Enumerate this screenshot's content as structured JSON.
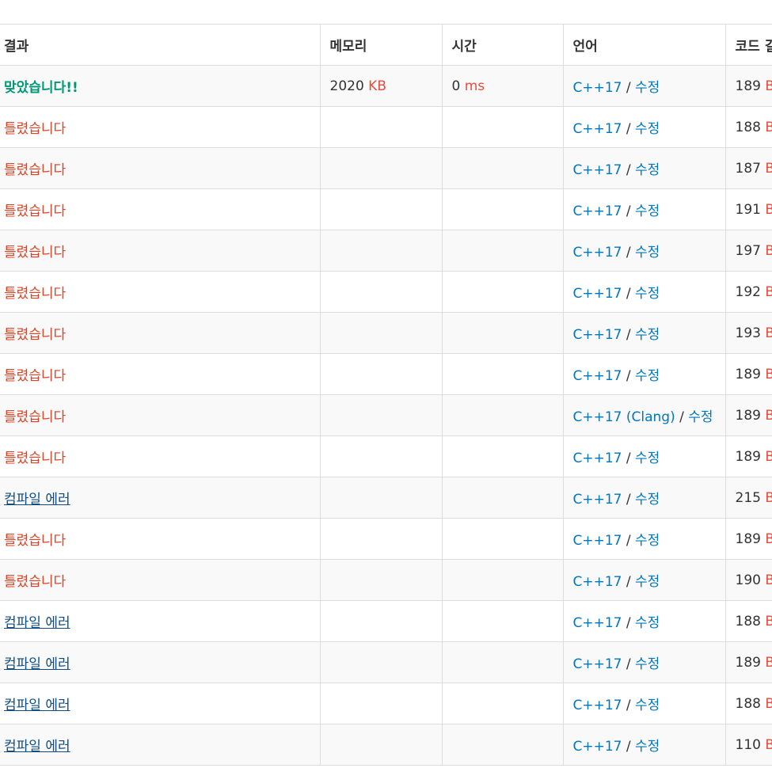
{
  "headers": {
    "result": "결과",
    "memory": "메모리",
    "time": "시간",
    "language": "언어",
    "code_length": "코드 길이"
  },
  "separator": " / ",
  "rows": [
    {
      "result": "맞았습니다!!",
      "result_type": "ac",
      "memory": "2020",
      "memory_unit": "KB",
      "time": "0",
      "time_unit": "ms",
      "language": "C++17",
      "edit": "수정",
      "code_length": "189",
      "code_unit": "B"
    },
    {
      "result": "틀렸습니다",
      "result_type": "wa",
      "memory": "",
      "memory_unit": "",
      "time": "",
      "time_unit": "",
      "language": "C++17",
      "edit": "수정",
      "code_length": "188",
      "code_unit": "B"
    },
    {
      "result": "틀렸습니다",
      "result_type": "wa",
      "memory": "",
      "memory_unit": "",
      "time": "",
      "time_unit": "",
      "language": "C++17",
      "edit": "수정",
      "code_length": "187",
      "code_unit": "B"
    },
    {
      "result": "틀렸습니다",
      "result_type": "wa",
      "memory": "",
      "memory_unit": "",
      "time": "",
      "time_unit": "",
      "language": "C++17",
      "edit": "수정",
      "code_length": "191",
      "code_unit": "B"
    },
    {
      "result": "틀렸습니다",
      "result_type": "wa",
      "memory": "",
      "memory_unit": "",
      "time": "",
      "time_unit": "",
      "language": "C++17",
      "edit": "수정",
      "code_length": "197",
      "code_unit": "B"
    },
    {
      "result": "틀렸습니다",
      "result_type": "wa",
      "memory": "",
      "memory_unit": "",
      "time": "",
      "time_unit": "",
      "language": "C++17",
      "edit": "수정",
      "code_length": "192",
      "code_unit": "B"
    },
    {
      "result": "틀렸습니다",
      "result_type": "wa",
      "memory": "",
      "memory_unit": "",
      "time": "",
      "time_unit": "",
      "language": "C++17",
      "edit": "수정",
      "code_length": "193",
      "code_unit": "B"
    },
    {
      "result": "틀렸습니다",
      "result_type": "wa",
      "memory": "",
      "memory_unit": "",
      "time": "",
      "time_unit": "",
      "language": "C++17",
      "edit": "수정",
      "code_length": "189",
      "code_unit": "B"
    },
    {
      "result": "틀렸습니다",
      "result_type": "wa",
      "memory": "",
      "memory_unit": "",
      "time": "",
      "time_unit": "",
      "language": "C++17 (Clang)",
      "edit": "수정",
      "code_length": "189",
      "code_unit": "B"
    },
    {
      "result": "틀렸습니다",
      "result_type": "wa",
      "memory": "",
      "memory_unit": "",
      "time": "",
      "time_unit": "",
      "language": "C++17",
      "edit": "수정",
      "code_length": "189",
      "code_unit": "B"
    },
    {
      "result": "컴파일 에러",
      "result_type": "ce",
      "memory": "",
      "memory_unit": "",
      "time": "",
      "time_unit": "",
      "language": "C++17",
      "edit": "수정",
      "code_length": "215",
      "code_unit": "B"
    },
    {
      "result": "틀렸습니다",
      "result_type": "wa",
      "memory": "",
      "memory_unit": "",
      "time": "",
      "time_unit": "",
      "language": "C++17",
      "edit": "수정",
      "code_length": "189",
      "code_unit": "B"
    },
    {
      "result": "틀렸습니다",
      "result_type": "wa",
      "memory": "",
      "memory_unit": "",
      "time": "",
      "time_unit": "",
      "language": "C++17",
      "edit": "수정",
      "code_length": "190",
      "code_unit": "B"
    },
    {
      "result": "컴파일 에러",
      "result_type": "ce",
      "memory": "",
      "memory_unit": "",
      "time": "",
      "time_unit": "",
      "language": "C++17",
      "edit": "수정",
      "code_length": "188",
      "code_unit": "B"
    },
    {
      "result": "컴파일 에러",
      "result_type": "ce",
      "memory": "",
      "memory_unit": "",
      "time": "",
      "time_unit": "",
      "language": "C++17",
      "edit": "수정",
      "code_length": "189",
      "code_unit": "B"
    },
    {
      "result": "컴파일 에러",
      "result_type": "ce",
      "memory": "",
      "memory_unit": "",
      "time": "",
      "time_unit": "",
      "language": "C++17",
      "edit": "수정",
      "code_length": "188",
      "code_unit": "B"
    },
    {
      "result": "컴파일 에러",
      "result_type": "ce",
      "memory": "",
      "memory_unit": "",
      "time": "",
      "time_unit": "",
      "language": "C++17",
      "edit": "수정",
      "code_length": "110",
      "code_unit": "B"
    }
  ],
  "colors": {
    "accepted": "#009874",
    "wrong": "#dd4124",
    "compile_error": "#0f4c81",
    "link": "#0076c0",
    "unit": "#e74c3c",
    "border": "#dddddd",
    "stripe": "#f9f9f9"
  }
}
